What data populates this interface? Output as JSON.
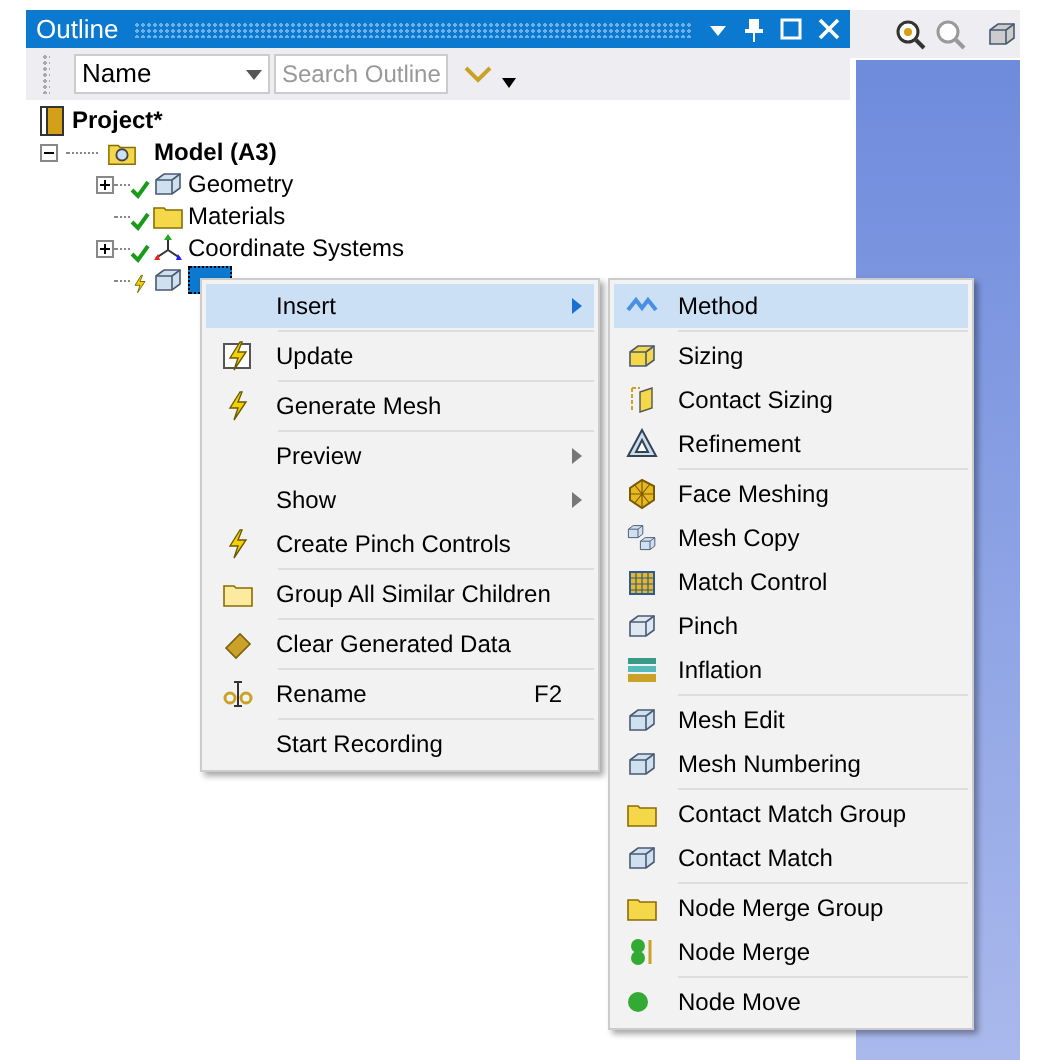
{
  "panel": {
    "title": "Outline"
  },
  "toolbar": {
    "column_select": "Name",
    "search": {
      "placeholder": "Search Outline"
    }
  },
  "tree": [
    {
      "label": "Project*",
      "bold": true,
      "children": [
        {
          "label": "Model (A3)",
          "bold": true,
          "expanded": true,
          "children": [
            {
              "label": "Geometry",
              "expander": true,
              "up_to_date": true,
              "selected": false
            },
            {
              "label": "Materials",
              "expander": false,
              "up_to_date": true,
              "selected": false
            },
            {
              "label": "Coordinate Systems",
              "expander": true,
              "up_to_date": true,
              "selected": false
            },
            {
              "expander": false,
              "up_to_date": false,
              "selected": true
            }
          ]
        }
      ]
    }
  ],
  "context_menu": [
    {
      "label": "Insert",
      "submenu": true,
      "selected": true,
      "separator_before": false
    },
    {
      "label": "Update",
      "submenu": false,
      "selected": false,
      "separator_before": true
    },
    {
      "label": "Generate Mesh",
      "submenu": false,
      "selected": false,
      "separator_before": true
    },
    {
      "label": "Preview",
      "submenu": true,
      "selected": false,
      "separator_before": true
    },
    {
      "label": "Show",
      "submenu": true,
      "selected": false,
      "separator_before": false
    },
    {
      "label": "Create Pinch Controls",
      "submenu": false,
      "selected": false,
      "separator_before": false
    },
    {
      "label": "Group All Similar Children",
      "submenu": false,
      "selected": false,
      "separator_before": true
    },
    {
      "label": "Clear Generated Data",
      "submenu": false,
      "selected": false,
      "separator_before": true
    },
    {
      "label": "Rename",
      "shortcut": "F2",
      "submenu": false,
      "selected": false,
      "separator_before": true
    },
    {
      "label": "Start Recording",
      "submenu": false,
      "selected": false,
      "separator_before": true
    }
  ],
  "submenu": [
    {
      "label": "Method",
      "selected": true,
      "separator_before": false
    },
    {
      "label": "Sizing",
      "selected": false,
      "separator_before": true
    },
    {
      "label": "Contact Sizing",
      "selected": false,
      "separator_before": false
    },
    {
      "label": "Refinement",
      "selected": false,
      "separator_before": false
    },
    {
      "label": "Face Meshing",
      "selected": false,
      "separator_before": true
    },
    {
      "label": "Mesh Copy",
      "selected": false,
      "separator_before": false
    },
    {
      "label": "Match Control",
      "selected": false,
      "separator_before": false
    },
    {
      "label": "Pinch",
      "selected": false,
      "separator_before": false
    },
    {
      "label": "Inflation",
      "selected": false,
      "separator_before": false
    },
    {
      "label": "Mesh Edit",
      "selected": false,
      "separator_before": true
    },
    {
      "label": "Mesh Numbering",
      "selected": false,
      "separator_before": false
    },
    {
      "label": "Contact Match Group",
      "selected": false,
      "separator_before": true
    },
    {
      "label": "Contact Match",
      "selected": false,
      "separator_before": false
    },
    {
      "label": "Node Merge Group",
      "selected": false,
      "separator_before": true
    },
    {
      "label": "Node Merge",
      "selected": false,
      "separator_before": false
    },
    {
      "label": "Node Move",
      "selected": false,
      "separator_before": true
    }
  ]
}
